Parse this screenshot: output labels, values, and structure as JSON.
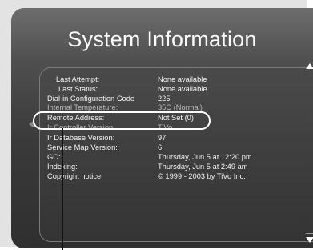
{
  "screen": {
    "title": "System Information"
  },
  "info_rows": [
    {
      "label": "Last Attempt:",
      "value": "None available"
    },
    {
      "label": "Last Status:",
      "value": "None available"
    },
    {
      "label": "Dial-in Configuration Code",
      "value": "225"
    },
    {
      "label": "Internal Temperature:",
      "value": "35C (Normal)"
    },
    {
      "label": "Remote Address:",
      "value": "Not Set (0)"
    },
    {
      "label": "Ir Controller Version:",
      "value": "TiVo"
    },
    {
      "label": "Ir Database Version:",
      "value": "97"
    },
    {
      "label": "Service Map Version:",
      "value": "6"
    },
    {
      "label": "GC:",
      "value": "Thursday, Jun 5 at 12:20 pm"
    },
    {
      "label": "Indexing:",
      "value": "Thursday, Jun 5 at 2:49 am"
    },
    {
      "label": "Copyright notice:",
      "value": "© 1999 - 2003 by TiVo Inc."
    }
  ],
  "icons": {
    "scroll_up": "up-arrow-icon",
    "scroll_down": "down-arrow-icon",
    "back": "left-arrow-icon"
  },
  "colors": {
    "screen_bg": "#3a3a3a",
    "text": "#f3f3f3",
    "highlight": "#ffffff"
  }
}
